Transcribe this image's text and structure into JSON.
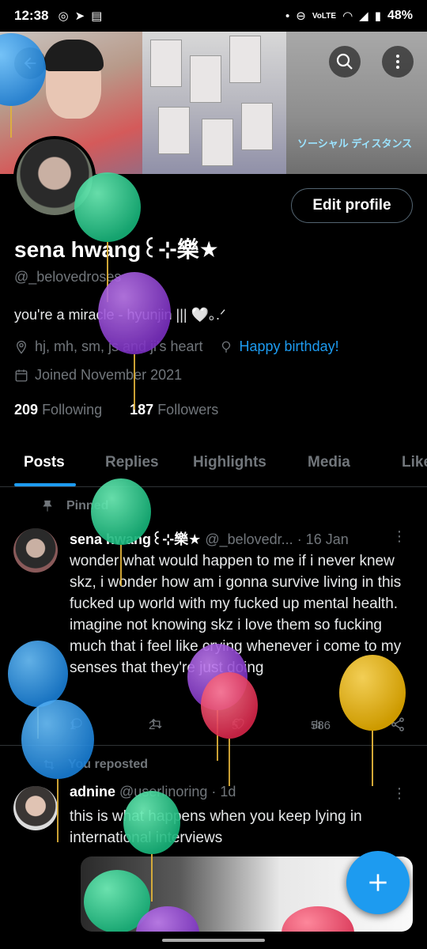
{
  "status_bar": {
    "time": "12:38",
    "network": "VoLTE",
    "battery": "48%"
  },
  "header": {
    "banner_caption": "ソーシャル ディスタンス",
    "back_icon": "arrow-left-icon",
    "search_icon": "search-icon",
    "more_icon": "more-vertical-icon"
  },
  "profile": {
    "edit_label": "Edit profile",
    "name": "sena hwang꒰⊹樂★",
    "handle": "@_belovedroses",
    "bio": "you're a miracle - hyunjin ||| 🤍｡.ᐟ",
    "location": "hj, mh, sm, js and ji's heart",
    "website": "Happy birthday!",
    "joined": "Joined November 2021",
    "following_count": "209",
    "following_label": "Following",
    "followers_count": "187",
    "followers_label": "Followers"
  },
  "tabs": [
    "Posts",
    "Replies",
    "Highlights",
    "Media",
    "Likes"
  ],
  "tweets": [
    {
      "context": "Pinned",
      "name": "sena hwang꒰⊹樂★",
      "handle": "@_belovedr...",
      "time": "· 16 Jan",
      "text": "wonder what would happen to me if i never knew skz, i wonder how am i gonna survive living in this fucked up world with my fucked up mental health. imagine not knowing skz i love them so fucking much that i feel like crying whenever i come to my senses that they're just doing",
      "replies": "1",
      "reposts": "2",
      "likes": "5",
      "views": "586"
    },
    {
      "context": "You reposted",
      "name": "adnine",
      "handle": "@userlinoring",
      "time": "· 1d",
      "text": "this is what happens when you keep lying in international interviews"
    }
  ],
  "colors": {
    "accent": "#1d9bf0",
    "background": "#000000",
    "muted": "#71767b"
  }
}
